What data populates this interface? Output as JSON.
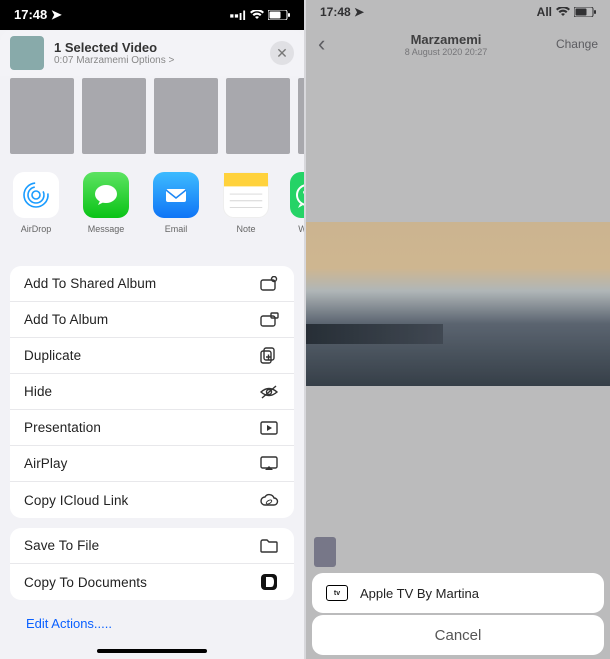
{
  "left": {
    "status": {
      "time": "17:48",
      "loc": "◀",
      "signal": "••ıl",
      "wifi": "wifi",
      "batt": "70"
    },
    "header": {
      "title": "1 Selected Video",
      "subtitle": "0:07 Marzamemi Options >",
      "close": "✕"
    },
    "apps": [
      {
        "key": "airdrop",
        "label": "AirDrop"
      },
      {
        "key": "message",
        "label": "Message"
      },
      {
        "key": "email",
        "label": "Email"
      },
      {
        "key": "note",
        "label": "Note"
      },
      {
        "key": "whats",
        "label": "Wh"
      }
    ],
    "group1": [
      {
        "label": "Add To Shared Album",
        "icon": "shared-album"
      },
      {
        "label": "Add To Album",
        "icon": "album"
      },
      {
        "label": "Duplicate",
        "icon": "duplicate"
      },
      {
        "label": "Hide",
        "icon": "hide"
      },
      {
        "label": "Presentation",
        "icon": "present"
      },
      {
        "label": "AirPlay",
        "icon": "airplay"
      },
      {
        "label": "Copy ICloud Link",
        "icon": "cloud"
      }
    ],
    "group2": [
      {
        "label": "Save To File",
        "icon": "folder"
      },
      {
        "label": "Copy To Documents",
        "icon": "docs"
      }
    ],
    "edit": "Edit Actions....."
  },
  "right": {
    "status": {
      "time": "17:48",
      "loc": "◀",
      "carrier": "All",
      "wifi": "wifi",
      "batt": "70"
    },
    "nav": {
      "back": "‹",
      "title": "Marzamemi",
      "subtitle": "8 August 2020 20:27",
      "change": "Change"
    },
    "airplay": {
      "device": "Apple TV By Martina"
    },
    "cancel": "Cancel"
  }
}
